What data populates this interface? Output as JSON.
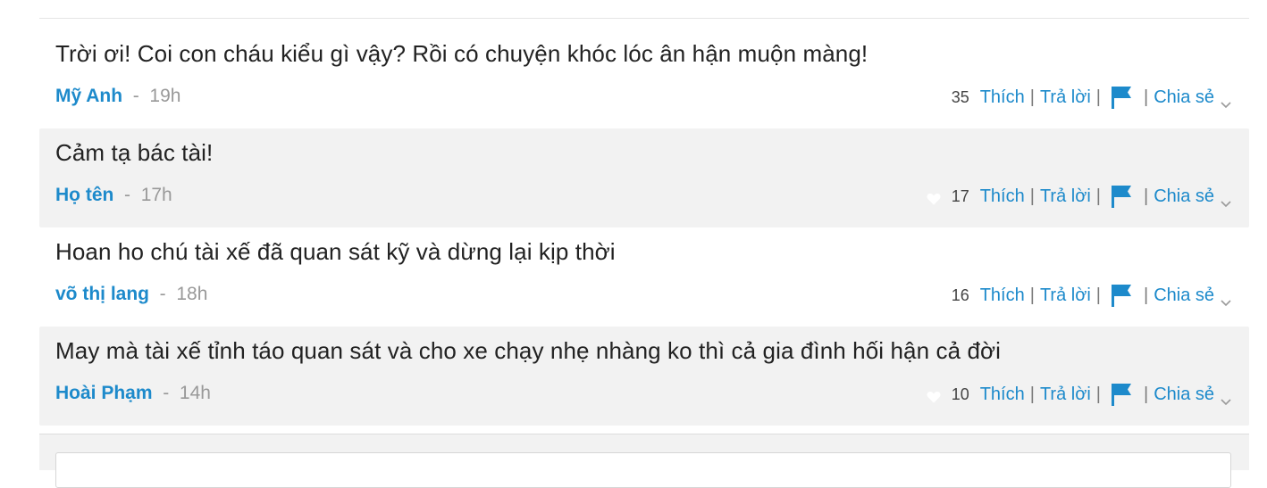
{
  "actions": {
    "like": "Thích",
    "reply": "Trả lời",
    "share": "Chia sẻ",
    "separator": "|",
    "time_separator": "-"
  },
  "icons": {
    "flag": "flag-icon",
    "heart": "heart-icon",
    "chevron": "chevron-down-icon"
  },
  "colors": {
    "link": "#1d8acb",
    "shaded_bg": "#f2f2f2"
  },
  "comments": [
    {
      "text": "Trời ơi! Coi con cháu kiểu gì vậy? Rồi có chuyện khóc lóc ân hận muộn màng!",
      "author": "Mỹ Anh",
      "time": "19h",
      "likes": "35",
      "shaded": false
    },
    {
      "text": "Cảm tạ bác tài!",
      "author": "Họ tên",
      "time": "17h",
      "likes": "17",
      "shaded": true
    },
    {
      "text": "Hoan ho chú tài xế đã quan sát kỹ và dừng lại kịp thời",
      "author": "võ thị lang",
      "time": "18h",
      "likes": "16",
      "shaded": false
    },
    {
      "text": "May mà tài xế tỉnh táo quan sát và cho xe chạy nhẹ nhàng ko thì cả gia đình hối hận cả đời",
      "author": "Hoài Phạm",
      "time": "14h",
      "likes": "10",
      "shaded": true
    }
  ]
}
